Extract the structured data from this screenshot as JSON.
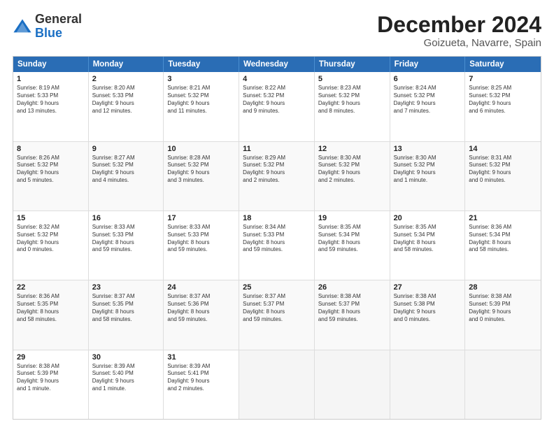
{
  "logo": {
    "general": "General",
    "blue": "Blue"
  },
  "title": "December 2024",
  "location": "Goizueta, Navarre, Spain",
  "headers": [
    "Sunday",
    "Monday",
    "Tuesday",
    "Wednesday",
    "Thursday",
    "Friday",
    "Saturday"
  ],
  "rows": [
    [
      {
        "day": "1",
        "lines": [
          "Sunrise: 8:19 AM",
          "Sunset: 5:33 PM",
          "Daylight: 9 hours",
          "and 13 minutes."
        ]
      },
      {
        "day": "2",
        "lines": [
          "Sunrise: 8:20 AM",
          "Sunset: 5:33 PM",
          "Daylight: 9 hours",
          "and 12 minutes."
        ]
      },
      {
        "day": "3",
        "lines": [
          "Sunrise: 8:21 AM",
          "Sunset: 5:32 PM",
          "Daylight: 9 hours",
          "and 11 minutes."
        ]
      },
      {
        "day": "4",
        "lines": [
          "Sunrise: 8:22 AM",
          "Sunset: 5:32 PM",
          "Daylight: 9 hours",
          "and 9 minutes."
        ]
      },
      {
        "day": "5",
        "lines": [
          "Sunrise: 8:23 AM",
          "Sunset: 5:32 PM",
          "Daylight: 9 hours",
          "and 8 minutes."
        ]
      },
      {
        "day": "6",
        "lines": [
          "Sunrise: 8:24 AM",
          "Sunset: 5:32 PM",
          "Daylight: 9 hours",
          "and 7 minutes."
        ]
      },
      {
        "day": "7",
        "lines": [
          "Sunrise: 8:25 AM",
          "Sunset: 5:32 PM",
          "Daylight: 9 hours",
          "and 6 minutes."
        ]
      }
    ],
    [
      {
        "day": "8",
        "lines": [
          "Sunrise: 8:26 AM",
          "Sunset: 5:32 PM",
          "Daylight: 9 hours",
          "and 5 minutes."
        ]
      },
      {
        "day": "9",
        "lines": [
          "Sunrise: 8:27 AM",
          "Sunset: 5:32 PM",
          "Daylight: 9 hours",
          "and 4 minutes."
        ]
      },
      {
        "day": "10",
        "lines": [
          "Sunrise: 8:28 AM",
          "Sunset: 5:32 PM",
          "Daylight: 9 hours",
          "and 3 minutes."
        ]
      },
      {
        "day": "11",
        "lines": [
          "Sunrise: 8:29 AM",
          "Sunset: 5:32 PM",
          "Daylight: 9 hours",
          "and 2 minutes."
        ]
      },
      {
        "day": "12",
        "lines": [
          "Sunrise: 8:30 AM",
          "Sunset: 5:32 PM",
          "Daylight: 9 hours",
          "and 2 minutes."
        ]
      },
      {
        "day": "13",
        "lines": [
          "Sunrise: 8:30 AM",
          "Sunset: 5:32 PM",
          "Daylight: 9 hours",
          "and 1 minute."
        ]
      },
      {
        "day": "14",
        "lines": [
          "Sunrise: 8:31 AM",
          "Sunset: 5:32 PM",
          "Daylight: 9 hours",
          "and 0 minutes."
        ]
      }
    ],
    [
      {
        "day": "15",
        "lines": [
          "Sunrise: 8:32 AM",
          "Sunset: 5:32 PM",
          "Daylight: 9 hours",
          "and 0 minutes."
        ]
      },
      {
        "day": "16",
        "lines": [
          "Sunrise: 8:33 AM",
          "Sunset: 5:33 PM",
          "Daylight: 8 hours",
          "and 59 minutes."
        ]
      },
      {
        "day": "17",
        "lines": [
          "Sunrise: 8:33 AM",
          "Sunset: 5:33 PM",
          "Daylight: 8 hours",
          "and 59 minutes."
        ]
      },
      {
        "day": "18",
        "lines": [
          "Sunrise: 8:34 AM",
          "Sunset: 5:33 PM",
          "Daylight: 8 hours",
          "and 59 minutes."
        ]
      },
      {
        "day": "19",
        "lines": [
          "Sunrise: 8:35 AM",
          "Sunset: 5:34 PM",
          "Daylight: 8 hours",
          "and 59 minutes."
        ]
      },
      {
        "day": "20",
        "lines": [
          "Sunrise: 8:35 AM",
          "Sunset: 5:34 PM",
          "Daylight: 8 hours",
          "and 58 minutes."
        ]
      },
      {
        "day": "21",
        "lines": [
          "Sunrise: 8:36 AM",
          "Sunset: 5:34 PM",
          "Daylight: 8 hours",
          "and 58 minutes."
        ]
      }
    ],
    [
      {
        "day": "22",
        "lines": [
          "Sunrise: 8:36 AM",
          "Sunset: 5:35 PM",
          "Daylight: 8 hours",
          "and 58 minutes."
        ]
      },
      {
        "day": "23",
        "lines": [
          "Sunrise: 8:37 AM",
          "Sunset: 5:35 PM",
          "Daylight: 8 hours",
          "and 58 minutes."
        ]
      },
      {
        "day": "24",
        "lines": [
          "Sunrise: 8:37 AM",
          "Sunset: 5:36 PM",
          "Daylight: 8 hours",
          "and 59 minutes."
        ]
      },
      {
        "day": "25",
        "lines": [
          "Sunrise: 8:37 AM",
          "Sunset: 5:37 PM",
          "Daylight: 8 hours",
          "and 59 minutes."
        ]
      },
      {
        "day": "26",
        "lines": [
          "Sunrise: 8:38 AM",
          "Sunset: 5:37 PM",
          "Daylight: 8 hours",
          "and 59 minutes."
        ]
      },
      {
        "day": "27",
        "lines": [
          "Sunrise: 8:38 AM",
          "Sunset: 5:38 PM",
          "Daylight: 9 hours",
          "and 0 minutes."
        ]
      },
      {
        "day": "28",
        "lines": [
          "Sunrise: 8:38 AM",
          "Sunset: 5:39 PM",
          "Daylight: 9 hours",
          "and 0 minutes."
        ]
      }
    ],
    [
      {
        "day": "29",
        "lines": [
          "Sunrise: 8:38 AM",
          "Sunset: 5:39 PM",
          "Daylight: 9 hours",
          "and 1 minute."
        ]
      },
      {
        "day": "30",
        "lines": [
          "Sunrise: 8:39 AM",
          "Sunset: 5:40 PM",
          "Daylight: 9 hours",
          "and 1 minute."
        ]
      },
      {
        "day": "31",
        "lines": [
          "Sunrise: 8:39 AM",
          "Sunset: 5:41 PM",
          "Daylight: 9 hours",
          "and 2 minutes."
        ]
      },
      {
        "day": "",
        "lines": []
      },
      {
        "day": "",
        "lines": []
      },
      {
        "day": "",
        "lines": []
      },
      {
        "day": "",
        "lines": []
      }
    ]
  ]
}
